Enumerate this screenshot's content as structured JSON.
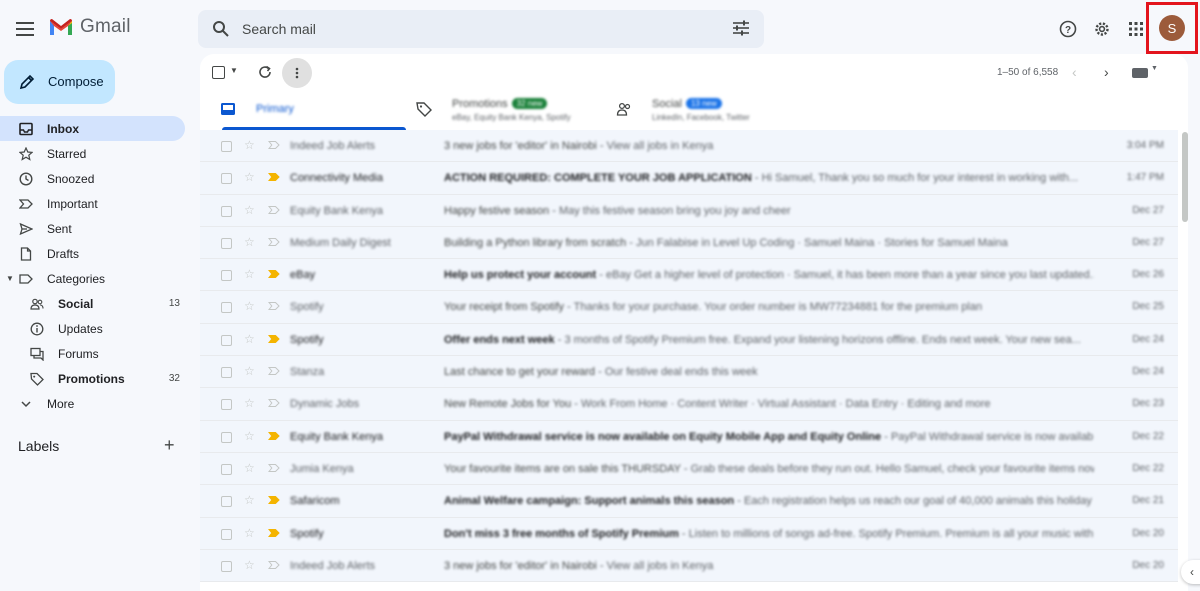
{
  "app": {
    "name": "Gmail"
  },
  "header": {
    "search_placeholder": "Search mail",
    "avatar_initial": "S",
    "colors": {
      "avatar_bg": "#9c5b3b",
      "highlight_border": "#e3141d"
    }
  },
  "sidebar": {
    "compose_label": "Compose",
    "items": [
      {
        "label": "Inbox",
        "icon": "inbox-icon",
        "active": true
      },
      {
        "label": "Starred",
        "icon": "star-icon"
      },
      {
        "label": "Snoozed",
        "icon": "clock-icon"
      },
      {
        "label": "Important",
        "icon": "important-icon"
      },
      {
        "label": "Sent",
        "icon": "send-icon"
      },
      {
        "label": "Drafts",
        "icon": "draft-icon"
      },
      {
        "label": "Categories",
        "icon": "label-icon"
      }
    ],
    "categories": [
      {
        "label": "Social",
        "count": "13",
        "icon": "people-icon"
      },
      {
        "label": "Updates",
        "icon": "info-icon"
      },
      {
        "label": "Forums",
        "icon": "forum-icon"
      },
      {
        "label": "Promotions",
        "count": "32",
        "icon": "tag-icon"
      }
    ],
    "more_label": "More",
    "labels_heading": "Labels"
  },
  "toolbar": {
    "pager": "1–50 of 6,558"
  },
  "tabs": [
    {
      "label": "Primary",
      "sub": ""
    },
    {
      "label": "Promotions",
      "badge": "32 new",
      "sub": "eBay, Equity Bank Kenya, Spotify"
    },
    {
      "label": "Social",
      "badge": "13 new",
      "sub": "LinkedIn, Facebook, Twitter"
    }
  ],
  "emails": [
    {
      "sender": "Indeed Job Alerts",
      "subject": "3 new jobs for 'editor' in Nairobi",
      "snippet": "View all jobs in Kenya",
      "date": "3:04 PM",
      "read": true
    },
    {
      "sender": "Connectivity Media",
      "subject": "ACTION REQUIRED: COMPLETE YOUR JOB APPLICATION",
      "snippet": "Hi Samuel, Thank you so much for your interest in working with...",
      "date": "1:47 PM",
      "read": false
    },
    {
      "sender": "Equity Bank Kenya",
      "subject": "Happy festive season",
      "snippet": "May this festive season bring you joy and cheer",
      "date": "Dec 27",
      "read": true
    },
    {
      "sender": "Medium Daily Digest",
      "subject": "Building a Python library from scratch",
      "snippet": "Jun Falabise in Level Up Coding · Samuel Maina · Stories for Samuel Maina",
      "date": "Dec 27",
      "read": true
    },
    {
      "sender": "eBay",
      "subject": "Help us protect your account",
      "snippet": "eBay Get a higher level of protection · Samuel, it has been more than a year since you last updated...",
      "date": "Dec 26",
      "read": false
    },
    {
      "sender": "Spotify",
      "subject": "Your receipt from Spotify",
      "snippet": "Thanks for your purchase. Your order number is MW77234881 for the premium plan",
      "date": "Dec 25",
      "read": true
    },
    {
      "sender": "Spotify",
      "subject": "Offer ends next week",
      "snippet": "3 months of Spotify Premium free. Expand your listening horizons offline. Ends next week. Your new sea...",
      "date": "Dec 24",
      "read": false
    },
    {
      "sender": "Stanza",
      "subject": "Last chance to get your reward",
      "snippet": "Our festive deal ends this week",
      "date": "Dec 24",
      "read": true
    },
    {
      "sender": "Dynamic Jobs",
      "subject": "New Remote Jobs for You",
      "snippet": "Work From Home · Content Writer · Virtual Assistant · Data Entry · Editing and more",
      "date": "Dec 23",
      "read": true
    },
    {
      "sender": "Equity Bank Kenya",
      "subject": "PayPal Withdrawal service is now available on Equity Mobile App and Equity Online",
      "snippet": "PayPal Withdrawal service is now available on...",
      "date": "Dec 22",
      "read": false
    },
    {
      "sender": "Jumia Kenya",
      "subject": "Your favourite items are on sale this THURSDAY",
      "snippet": "Grab these deals before they run out. Hello Samuel, check your favourite items now",
      "date": "Dec 22",
      "read": true
    },
    {
      "sender": "Safaricom",
      "subject": "Animal Welfare campaign: Support animals this season",
      "snippet": "Each registration helps us reach our goal of 40,000 animals this holiday",
      "date": "Dec 21",
      "read": false
    },
    {
      "sender": "Spotify",
      "subject": "Don't miss 3 free months of Spotify Premium",
      "snippet": "Listen to millions of songs ad-free. Spotify Premium. Premium is all your music with...",
      "date": "Dec 20",
      "read": false
    },
    {
      "sender": "Indeed Job Alerts",
      "subject": "3 new jobs for 'editor' in Nairobi",
      "snippet": "View all jobs in Kenya",
      "date": "Dec 20",
      "read": true
    }
  ]
}
